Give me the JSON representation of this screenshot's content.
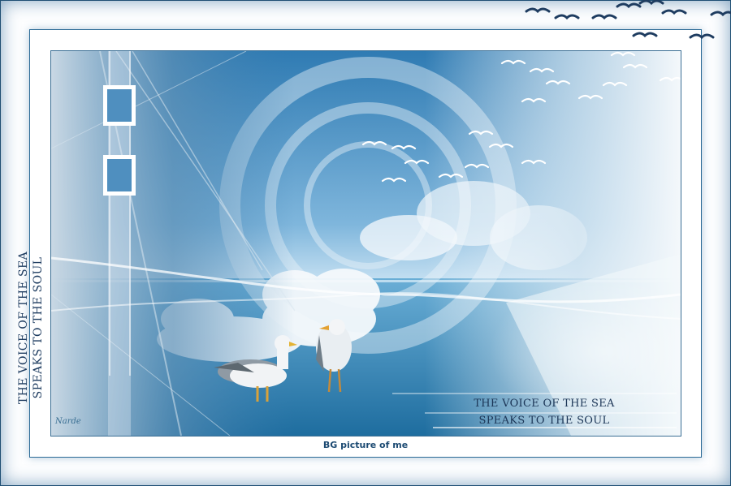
{
  "title_lines": [
    "THE VOICE OF THE SEA",
    "SPEAKS TO THE SOUL"
  ],
  "side_lines": [
    "THE VOICE OF THE SEA",
    "SPEAKS TO THE SOUL"
  ],
  "caption": "BG picture of me",
  "signature": "Narde",
  "colors": {
    "frame_border": "#1f4f74",
    "sky_deep": "#1f6ea3",
    "sky_light": "#cfe6f5",
    "text_dark": "#1e3c60"
  },
  "icons": [
    "seagull",
    "flying-bird",
    "cloud"
  ]
}
